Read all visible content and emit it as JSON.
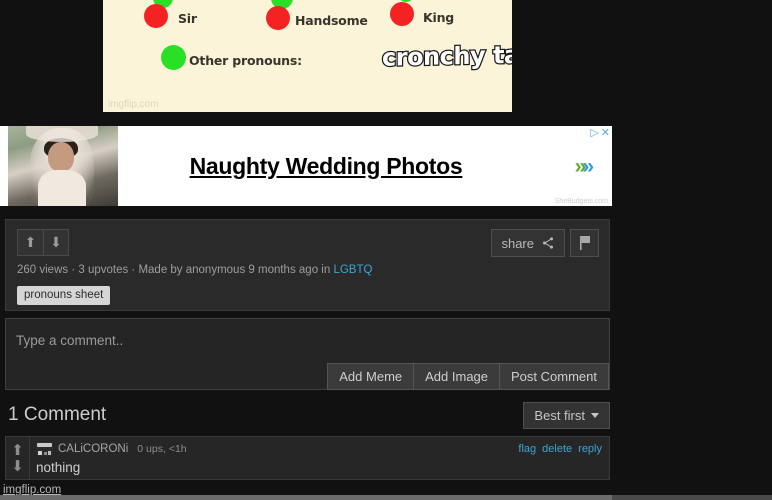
{
  "meme": {
    "background_color": "#fbf4d8",
    "watermark": "imgflip.com",
    "overlay_text": "cronchy taco",
    "items": [
      {
        "label": "Sir",
        "color": "#f42222",
        "kind": "red"
      },
      {
        "label": "Handsome",
        "color": "#f42222",
        "kind": "red"
      },
      {
        "label": "King",
        "color": "#f42222",
        "kind": "red"
      },
      {
        "label": "Other pronouns:",
        "color": "#2ae026",
        "kind": "green"
      }
    ]
  },
  "ad": {
    "headline": "Naughty Wedding Photos",
    "source": "SheBudgets.com",
    "info_icon": "▷",
    "close_icon": "✕",
    "arrow_icon": "»"
  },
  "stats": {
    "upvote_icon": "⬆",
    "downvote_icon": "⬇",
    "share_label": "share",
    "share_icon": "share-icon",
    "flag_icon": "⚑",
    "meta": "260 views · 3 upvotes · Made by anonymous 9 months ago in ",
    "views": "260 views",
    "upvotes": "3 upvotes",
    "author": "anonymous",
    "age": "9 months ago",
    "stream_link": "LGBTQ",
    "tag": "pronouns sheet",
    "link_color": "#3ba7d4"
  },
  "comment_box": {
    "placeholder": "Type a comment..",
    "value": "",
    "add_meme_label": "Add Meme",
    "add_image_label": "Add Image",
    "post_label": "Post Comment"
  },
  "comments_header": {
    "count_label": "1 Comment",
    "sort_label": "Best first"
  },
  "comment": {
    "username": "CALiCORONi",
    "stats": "0 ups, <1h",
    "body": "nothing",
    "flag_label": "flag",
    "delete_label": "delete",
    "reply_label": "reply",
    "upvote_icon": "⬆",
    "downvote_icon": "⬇"
  },
  "footer": {
    "watermark": "imgflip.com"
  }
}
